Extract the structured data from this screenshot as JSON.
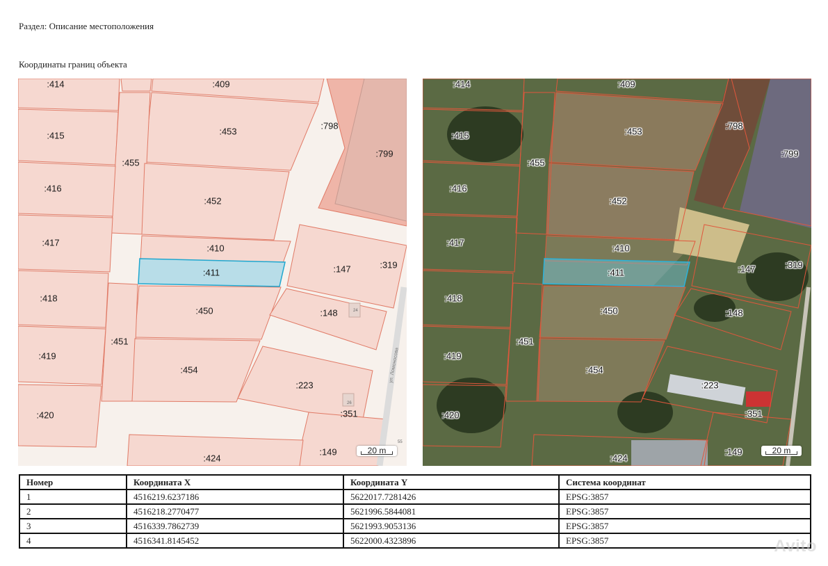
{
  "section_label": "Раздел: Описание местоположения",
  "coords_heading": "Координаты границ объекта",
  "map": {
    "parcels": [
      ":414",
      ":409",
      ":415",
      ":453",
      ":798",
      ":799",
      ":455",
      ":416",
      ":452",
      ":417",
      ":410",
      ":411",
      ":147",
      ":319",
      ":418",
      ":450",
      ":148",
      ":451",
      ":419",
      ":454",
      ":223",
      ":420",
      ":351",
      ":424",
      ":149"
    ],
    "scale": "20 m",
    "street": "ул. Ломоносова",
    "house_numbers": [
      "24",
      "26",
      "55"
    ],
    "highlight_parcel": ":411",
    "colors": {
      "parcel_fill": "#f6d8d0",
      "parcel_border": "#e07a66",
      "highlight_fill": "#b8dde8",
      "highlight_border": "#1fa7cf"
    }
  },
  "table": {
    "headers": [
      "Номер",
      "Координата X",
      "Координата Y",
      "Система координат"
    ],
    "rows": [
      [
        "1",
        "4516219.6237186",
        "5622017.7281426",
        "EPSG:3857"
      ],
      [
        "2",
        "4516218.2770477",
        "5621996.5844081",
        "EPSG:3857"
      ],
      [
        "3",
        "4516339.7862739",
        "5621993.9053136",
        "EPSG:3857"
      ],
      [
        "4",
        "4516341.8145452",
        "5622000.4323896",
        "EPSG:3857"
      ]
    ]
  },
  "watermark": "Avito"
}
